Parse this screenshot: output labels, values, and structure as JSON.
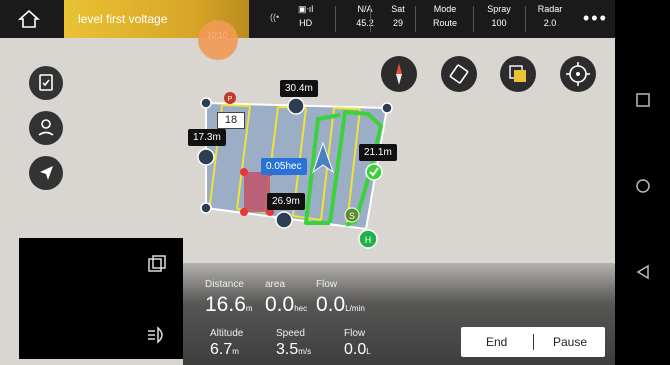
{
  "topbar": {
    "status_text": "level first voltage",
    "status_sub": "10:10",
    "hd_label": "HD",
    "battery": {
      "label": "N/A",
      "value": "45.2"
    },
    "sat": {
      "label": "Sat",
      "value": "29"
    },
    "mode": {
      "label": "Mode",
      "value": "Route"
    },
    "spray": {
      "label": "Spray",
      "value": "100"
    },
    "radar": {
      "label": "Radar",
      "value": "2.0"
    },
    "more": "•••"
  },
  "map": {
    "field_number": "18",
    "area_tag": "0.05hec",
    "edge_labels": {
      "top": "30.4m",
      "left": "17.3m",
      "right": "21.1m",
      "bottom": "26.9m"
    },
    "start_marker": "S",
    "home_marker": "H",
    "p_marker": "P"
  },
  "stats": {
    "distance": {
      "label": "Distance",
      "value": "16.6",
      "unit": "m"
    },
    "area": {
      "label": "area",
      "value": "0.0",
      "unit": "hec"
    },
    "flow_rate": {
      "label": "Flow",
      "value": "0.0",
      "unit": "L/min"
    },
    "altitude": {
      "label": "Altitude",
      "value": "6.7",
      "unit": "m"
    },
    "speed": {
      "label": "Speed",
      "value": "3.5",
      "unit": "m/s"
    },
    "flow_total": {
      "label": "Flow",
      "value": "0.0",
      "unit": "L"
    }
  },
  "actions": {
    "end": "End",
    "pause": "Pause"
  },
  "colors": {
    "accent": "#e9c235",
    "route": "#3ad13a",
    "field": "#8fa7c4",
    "tag_blue": "#2a73d6"
  }
}
